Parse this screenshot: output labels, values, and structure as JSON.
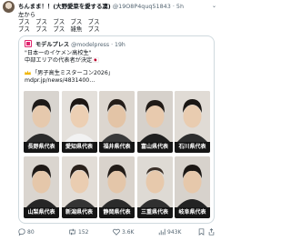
{
  "post": {
    "display_name": "ちんまま！！(大野愛菜を愛する凜)",
    "handle_time": "@19O8P4quq51843 · 5h",
    "lines": [
      "左から",
      "ブス　ブス　ブス　ブス　ブス",
      "ブス　ブス　ブス　雑魚　ブス"
    ]
  },
  "quote": {
    "name": "モデルプレス",
    "handle_time": "@modelpress · 19h",
    "line1": "\"日本一のイケメン高校生\"",
    "line2": "中部エリアの代表者が決定🇯🇵",
    "line3": "「男子高生ミスターコン2026」",
    "link": "mdpr.jp/news/4831400…"
  },
  "grid": {
    "top_row": [
      "長野県代表",
      "愛知県代表",
      "福井県代表",
      "富山県代表",
      "石川県代表"
    ],
    "bottom_row": [
      "山梨県代表",
      "新潟県代表",
      "静岡県代表",
      "三重県代表",
      "岐阜県代表"
    ]
  },
  "actions": {
    "replies": "80",
    "reposts": "152",
    "likes": "3.6K",
    "views": "943K"
  },
  "colors": {
    "brand": "#e0246e",
    "muted_text": "#536471",
    "border": "#cfd9de",
    "label_bg": "#151515"
  }
}
